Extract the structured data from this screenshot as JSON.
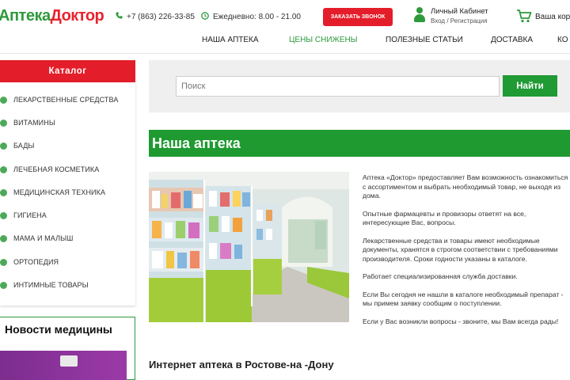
{
  "header": {
    "logo_part1": "Аптека",
    "logo_part2": "Доктор",
    "phone": "+7 (863) 226-33-85",
    "hours": "Ежедневно: 8.00 - 21.00",
    "call_button": "ЗАКАЗАТЬ ЗВОНОК",
    "cabinet_title": "Личный Кабинет",
    "cabinet_sub": "Вход / Регистрация",
    "cart_label": "Ваша кор"
  },
  "nav": {
    "items": [
      {
        "label": "НАША АПТЕКА",
        "highlight": false
      },
      {
        "label": "ЦЕНЫ СНИЖЕНЫ",
        "highlight": true
      },
      {
        "label": "ПОЛЕЗНЫЕ СТАТЬИ",
        "highlight": false
      },
      {
        "label": "ДОСТАВКА",
        "highlight": false
      },
      {
        "label": "КО",
        "highlight": false
      }
    ]
  },
  "sidebar": {
    "catalog_title": "Каталог",
    "items": [
      {
        "label": "ЛЕКАРСТВЕННЫЕ СРЕДСТВА"
      },
      {
        "label": "ВИТАМИНЫ"
      },
      {
        "label": "БАДЫ"
      },
      {
        "label": "ЛЕЧЕБНАЯ КОСМЕТИКА"
      },
      {
        "label": "МЕДИЦИНСКАЯ ТЕХНИКА"
      },
      {
        "label": "ГИГИЕНА"
      },
      {
        "label": "МАМА И МАЛЫШ"
      },
      {
        "label": "ОРТОПЕДИЯ"
      },
      {
        "label": "ИНТИМНЫЕ ТОВАРЫ"
      }
    ],
    "news_title": "Новости медицины"
  },
  "search": {
    "placeholder": "Поиск",
    "button": "Найти"
  },
  "main": {
    "section_title": "Наша аптека",
    "paragraphs": [
      "Аптека «Доктор» предоставляет Вам возможность ознакомиться с ассортиментом и выбрать необходимый товар, не выходя из дома.",
      "Опытные фармацевты и провизоры ответят на все, интересующие Вас, вопросы.",
      "Лекарственные средства и товары имеют необходимые документы, хранятся в строгом соответствии с требованиями производителя. Сроки годности указаны в каталоге.",
      "Работает специализированная служба доставки.",
      "Если Вы сегодня не нашли в каталоге необходимый препарат - мы примем заявку сообщим о поступлении.",
      "Если у Вас возникли вопросы - звоните, мы Вам всегда рады!"
    ],
    "subtitle": "Интернет аптека в Ростове-на -Дону"
  },
  "colors": {
    "brand_green": "#1e9a30",
    "brand_red": "#e31e2a"
  },
  "icons": {
    "phone": "phone-icon",
    "clock": "clock-icon",
    "user": "user-icon",
    "cart": "cart-icon",
    "bullet": "category-bullet-icon"
  }
}
